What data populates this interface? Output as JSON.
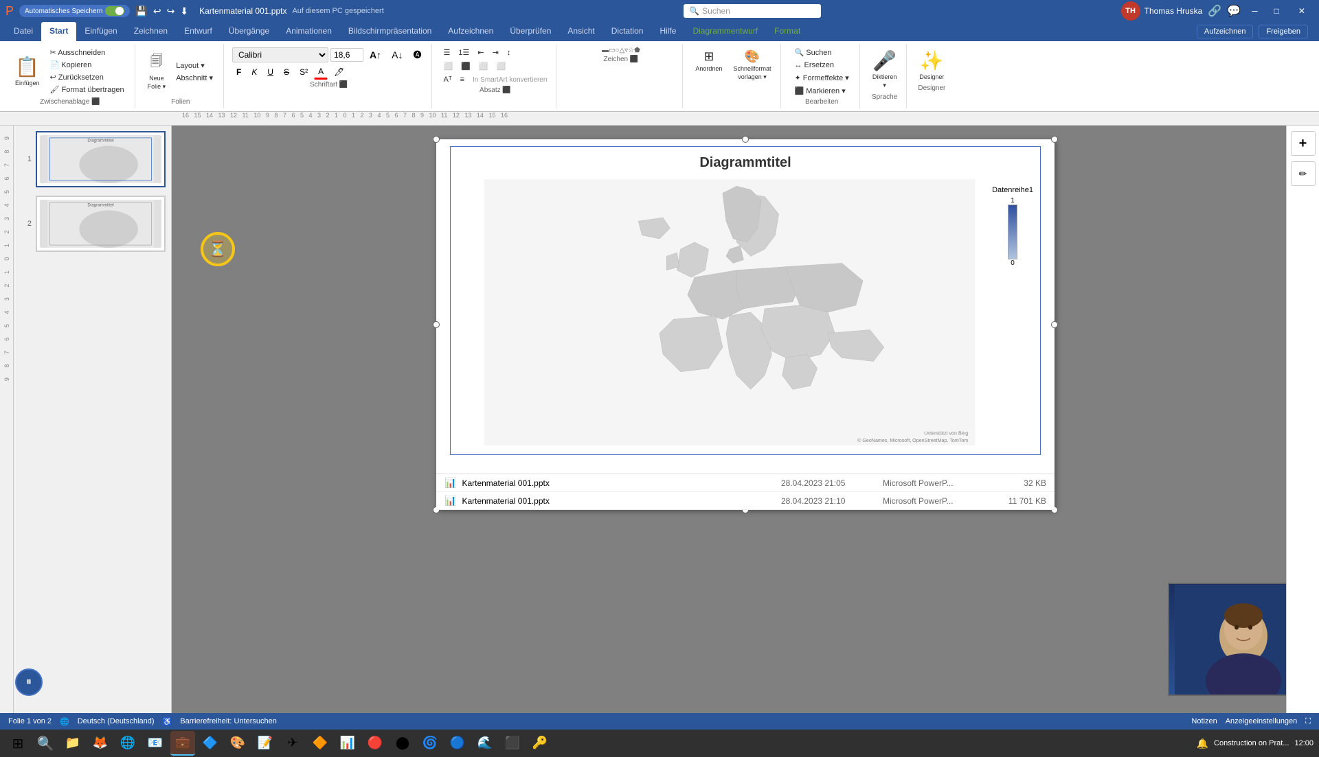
{
  "titlebar": {
    "autosave_label": "Automatisches Speichern",
    "filename": "Kartenmaterial 001.pptx",
    "save_location": "Auf diesem PC gespeichert",
    "search_placeholder": "Suchen",
    "user_name": "Thomas Hruska",
    "user_initials": "TH",
    "window_controls": {
      "minimize": "─",
      "maximize": "□",
      "close": "✕"
    }
  },
  "ribbon": {
    "tabs": [
      {
        "id": "datei",
        "label": "Datei",
        "active": false
      },
      {
        "id": "start",
        "label": "Start",
        "active": true
      },
      {
        "id": "einfuegen",
        "label": "Einfügen",
        "active": false
      },
      {
        "id": "zeichnen",
        "label": "Zeichnen",
        "active": false
      },
      {
        "id": "entwurf",
        "label": "Entwurf",
        "active": false
      },
      {
        "id": "uebergaenge",
        "label": "Übergänge",
        "active": false
      },
      {
        "id": "animationen",
        "label": "Animationen",
        "active": false
      },
      {
        "id": "bildschirmpraesenation",
        "label": "Bildschirmpräsentation",
        "active": false
      },
      {
        "id": "aufzeichnen",
        "label": "Aufzeichnen",
        "active": false
      },
      {
        "id": "ueberpruefen",
        "label": "Überprüfen",
        "active": false
      },
      {
        "id": "ansicht",
        "label": "Ansicht",
        "active": false
      },
      {
        "id": "dictation",
        "label": "Dictation",
        "active": false,
        "highlighted": false
      },
      {
        "id": "hilfe",
        "label": "Hilfe",
        "active": false
      },
      {
        "id": "diagrammentwurf",
        "label": "Diagrammentwurf",
        "active": false,
        "highlighted": true
      },
      {
        "id": "format",
        "label": "Format",
        "active": false
      }
    ],
    "groups": {
      "zwischenablage": {
        "label": "Zwischenablage",
        "buttons": [
          "Ausschneiden",
          "Kopieren",
          "Zurücksetzen",
          "Format übertragen"
        ]
      },
      "folien": {
        "label": "Folien",
        "buttons": [
          "Neue Folie",
          "Layout",
          "Abschnitt"
        ]
      },
      "schriftart": {
        "label": "Schriftart",
        "font": "Calibri",
        "size": "18,6",
        "buttons": [
          "F",
          "K",
          "U",
          "S",
          "A",
          "A"
        ]
      },
      "absatz": {
        "label": "Absatz"
      },
      "zeichen": {
        "label": "Zeichen"
      },
      "bearbeiten": {
        "label": "Bearbeiten",
        "buttons": [
          "Suchen",
          "Ersetzen",
          "Formeffekte"
        ]
      },
      "sprache": {
        "label": "Sprache",
        "buttons": [
          "Diktieren",
          "Markieren"
        ]
      },
      "designer": {
        "label": "Designer"
      }
    },
    "right_buttons": {
      "aufzeichnen": "Aufzeichnen",
      "freigeben": "Freigeben"
    }
  },
  "slides": [
    {
      "number": 1,
      "active": true
    },
    {
      "number": 2,
      "active": false
    }
  ],
  "chart": {
    "title": "Diagrammtitel",
    "legend_title": "Datenreihe1",
    "legend_max": "1",
    "legend_min": "0",
    "attribution": "© GeoNames, Microsoft, OpenStreetMap, TomTom",
    "attribution2": "Unterstützt von Bing"
  },
  "file_list": [
    {
      "name": "Kartenmaterial 001.pptx",
      "date": "28.04.2023 21:05",
      "type": "Microsoft PowerP...",
      "size": "32 KB"
    },
    {
      "name": "Kartenmaterial 001.pptx",
      "date": "28.04.2023 21:10",
      "type": "Microsoft PowerP...",
      "size": "11 701 KB"
    }
  ],
  "statusbar": {
    "slide_info": "Folie 1 von 2",
    "language": "Deutsch (Deutschland)",
    "accessibility": "Barrierefreiheit: Untersuchen",
    "notizen": "Notizen",
    "anzeigeeinstellungen": "Anzeigeeinstellungen"
  },
  "taskbar": {
    "start_icon": "⊞",
    "apps": [
      "🔍",
      "📁",
      "🦊",
      "🌐",
      "📧",
      "💼",
      "🎯",
      "🔵",
      "📝",
      "🔷",
      "📊",
      "🔴",
      "🔶",
      "📱",
      "⚙️",
      "🎵",
      "🌀",
      "🔮",
      "🔒",
      "💬",
      "🌊",
      "⬛",
      "🔑"
    ]
  }
}
